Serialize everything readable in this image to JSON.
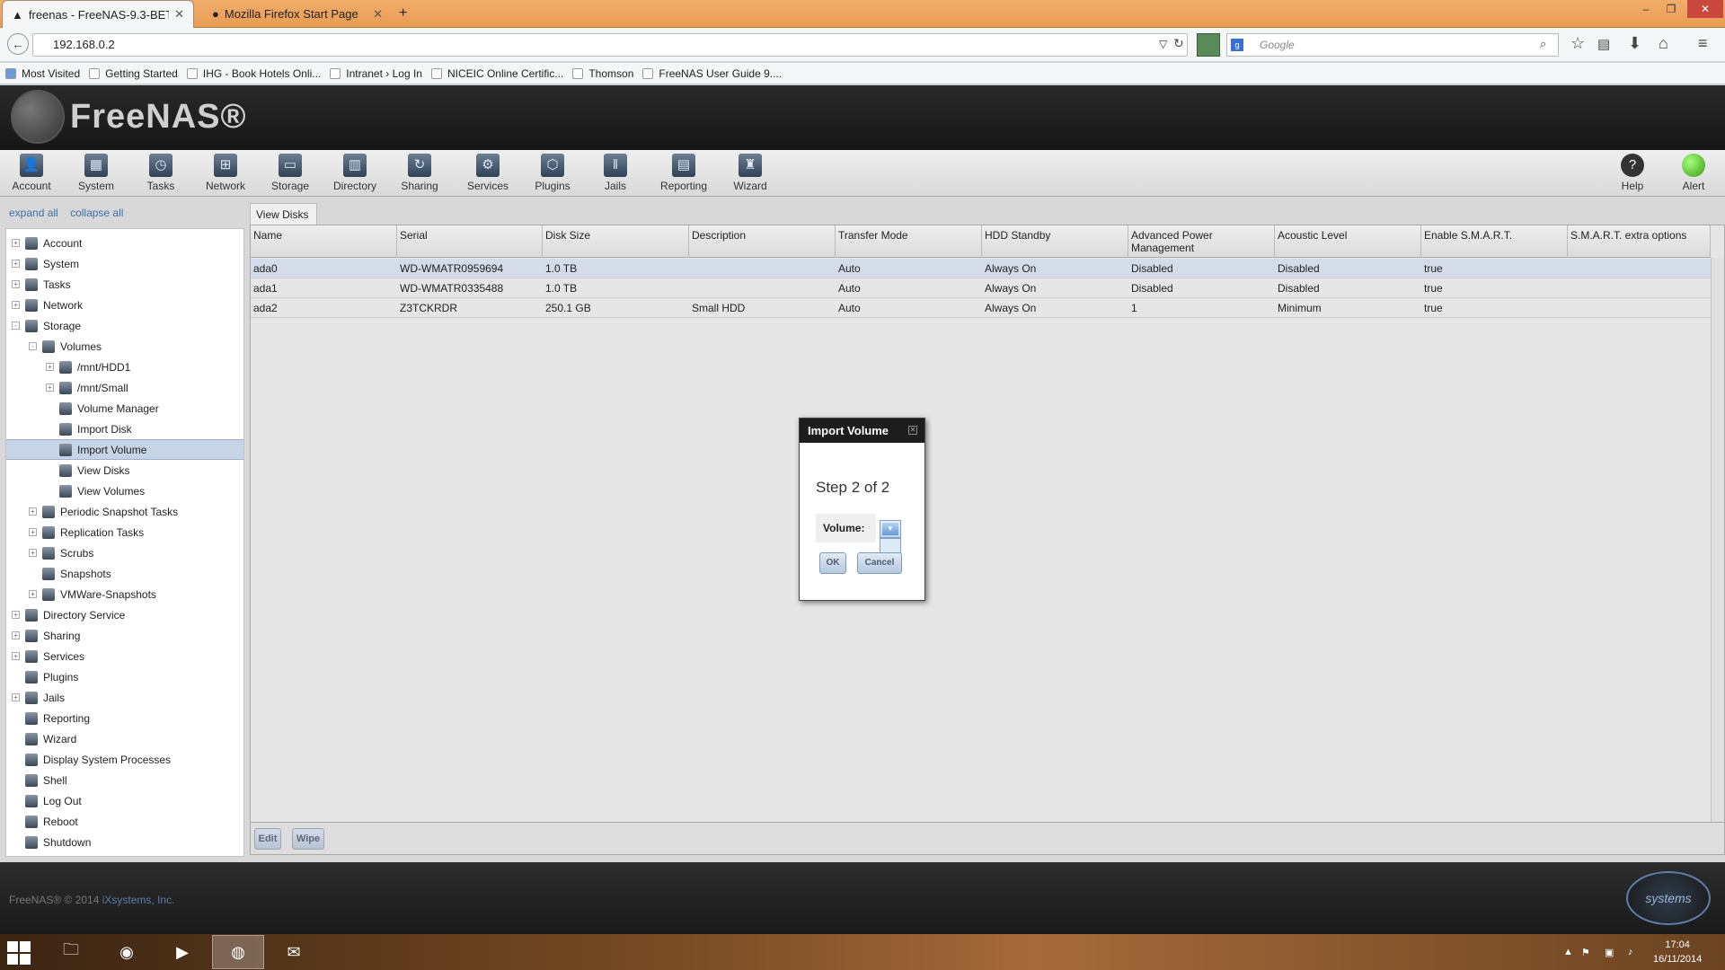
{
  "browser": {
    "tabs": [
      {
        "label": "freenas - FreeNAS-9.3-BET...",
        "active": true
      },
      {
        "label": "Mozilla Firefox Start Page",
        "active": false
      }
    ],
    "new_tab": "+",
    "url": "192.168.0.2",
    "search_placeholder": "Google",
    "bookmarks": [
      "Most Visited",
      "Getting Started",
      "IHG - Book Hotels Onli...",
      "Intranet › Log In",
      "NICEIC Online Certific...",
      "Thomson",
      "FreeNAS User Guide 9...."
    ]
  },
  "app": {
    "logo_text": "FreeNAS®"
  },
  "toolbar": {
    "items": [
      "Account",
      "System",
      "Tasks",
      "Network",
      "Storage",
      "Directory",
      "Sharing",
      "Services",
      "Plugins",
      "Jails",
      "Reporting",
      "Wizard"
    ],
    "help": "Help",
    "alert": "Alert"
  },
  "tree": {
    "expand_all": "expand all",
    "collapse_all": "collapse all",
    "nodes": [
      {
        "label": "Account",
        "level": 0,
        "exp": "+"
      },
      {
        "label": "System",
        "level": 0,
        "exp": "+"
      },
      {
        "label": "Tasks",
        "level": 0,
        "exp": "+"
      },
      {
        "label": "Network",
        "level": 0,
        "exp": "+"
      },
      {
        "label": "Storage",
        "level": 0,
        "exp": "-"
      },
      {
        "label": "Volumes",
        "level": 1,
        "exp": "-"
      },
      {
        "label": "/mnt/HDD1",
        "level": 2,
        "exp": "+"
      },
      {
        "label": "/mnt/Small",
        "level": 2,
        "exp": "+"
      },
      {
        "label": "Volume Manager",
        "level": 2,
        "exp": ""
      },
      {
        "label": "Import Disk",
        "level": 2,
        "exp": ""
      },
      {
        "label": "Import Volume",
        "level": 2,
        "exp": "",
        "selected": true
      },
      {
        "label": "View Disks",
        "level": 2,
        "exp": ""
      },
      {
        "label": "View Volumes",
        "level": 2,
        "exp": ""
      },
      {
        "label": "Periodic Snapshot Tasks",
        "level": 1,
        "exp": "+"
      },
      {
        "label": "Replication Tasks",
        "level": 1,
        "exp": "+"
      },
      {
        "label": "Scrubs",
        "level": 1,
        "exp": "+"
      },
      {
        "label": "Snapshots",
        "level": 1,
        "exp": ""
      },
      {
        "label": "VMWare-Snapshots",
        "level": 1,
        "exp": "+"
      },
      {
        "label": "Directory Service",
        "level": 0,
        "exp": "+"
      },
      {
        "label": "Sharing",
        "level": 0,
        "exp": "+"
      },
      {
        "label": "Services",
        "level": 0,
        "exp": "+"
      },
      {
        "label": "Plugins",
        "level": 0,
        "exp": ""
      },
      {
        "label": "Jails",
        "level": 0,
        "exp": "+"
      },
      {
        "label": "Reporting",
        "level": 0,
        "exp": ""
      },
      {
        "label": "Wizard",
        "level": 0,
        "exp": ""
      },
      {
        "label": "Display System Processes",
        "level": 0,
        "exp": ""
      },
      {
        "label": "Shell",
        "level": 0,
        "exp": ""
      },
      {
        "label": "Log Out",
        "level": 0,
        "exp": ""
      },
      {
        "label": "Reboot",
        "level": 0,
        "exp": ""
      },
      {
        "label": "Shutdown",
        "level": 0,
        "exp": ""
      }
    ]
  },
  "main": {
    "tab_label": "View Disks",
    "columns": [
      "Name",
      "Serial",
      "Disk Size",
      "Description",
      "Transfer Mode",
      "HDD Standby",
      "Advanced Power Management",
      "Acoustic Level",
      "Enable S.M.A.R.T.",
      "S.M.A.R.T. extra options"
    ],
    "rows": [
      [
        "ada0",
        "WD-WMATR0959694",
        "1.0 TB",
        "",
        "Auto",
        "Always On",
        "Disabled",
        "Disabled",
        "true",
        ""
      ],
      [
        "ada1",
        "WD-WMATR0335488",
        "1.0 TB",
        "",
        "Auto",
        "Always On",
        "Disabled",
        "Disabled",
        "true",
        ""
      ],
      [
        "ada2",
        "Z3TCKRDR",
        "250.1 GB",
        "Small HDD",
        "Auto",
        "Always On",
        "1",
        "Minimum",
        "true",
        ""
      ]
    ],
    "edit_button": "Edit",
    "wipe_button": "Wipe"
  },
  "dialog": {
    "title": "Import Volume",
    "step": "Step 2 of 2",
    "volume_label": "Volume:",
    "ok": "OK",
    "cancel": "Cancel"
  },
  "footer": {
    "copyright": "FreeNAS® © 2014",
    "company_link": "iXsystems, Inc.",
    "ix_logo": "systems"
  },
  "taskbar": {
    "time": "17:04",
    "date": "16/11/2014"
  },
  "colors": {
    "selection": "#c6d4e6",
    "header_bg": "#1f1f1f",
    "firefox_tabbar": "#eba35c"
  }
}
